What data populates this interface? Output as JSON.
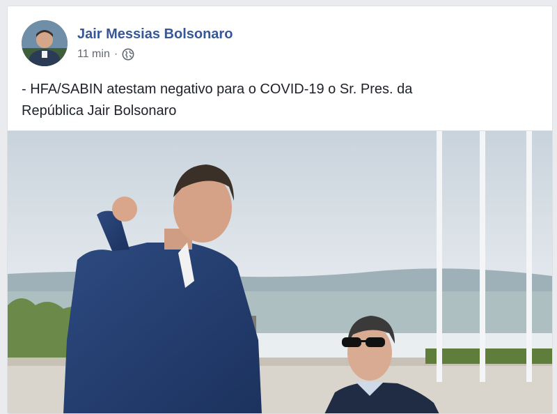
{
  "post": {
    "author": "Jair Messias Bolsonaro",
    "timestamp": "11 min",
    "separator": "·",
    "privacy_icon": "globe-icon",
    "text_line1": "- HFA/SABIN atestam negativo para o COVID-19 o Sr. Pres. da",
    "text_line2": "República Jair Bolsonaro"
  },
  "colors": {
    "author_link": "#365899",
    "meta_text": "#616770",
    "body_text": "#1d2129",
    "card_border": "#dddfe2"
  }
}
